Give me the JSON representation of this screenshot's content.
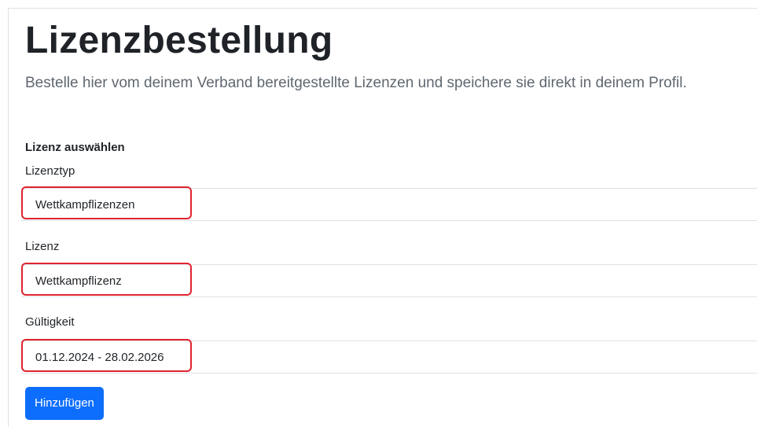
{
  "page": {
    "title": "Lizenzbestellung",
    "subtitle": "Bestelle hier vom deinem Verband bereitgestellte Lizenzen und speichere sie direkt in deinem Profil."
  },
  "form": {
    "section_heading": "Lizenz auswählen",
    "fields": [
      {
        "label": "Lizenztyp",
        "value": "Wettkampflizenzen"
      },
      {
        "label": "Lizenz",
        "value": "Wettkampflizenz"
      },
      {
        "label": "Gültigkeit",
        "value": "01.12.2024 - 28.02.2026"
      }
    ],
    "submit_label": "Hinzufügen"
  },
  "colors": {
    "primary_button": "#0d6efd",
    "highlight_border": "#e0242f",
    "field_border": "#dee2e6"
  }
}
